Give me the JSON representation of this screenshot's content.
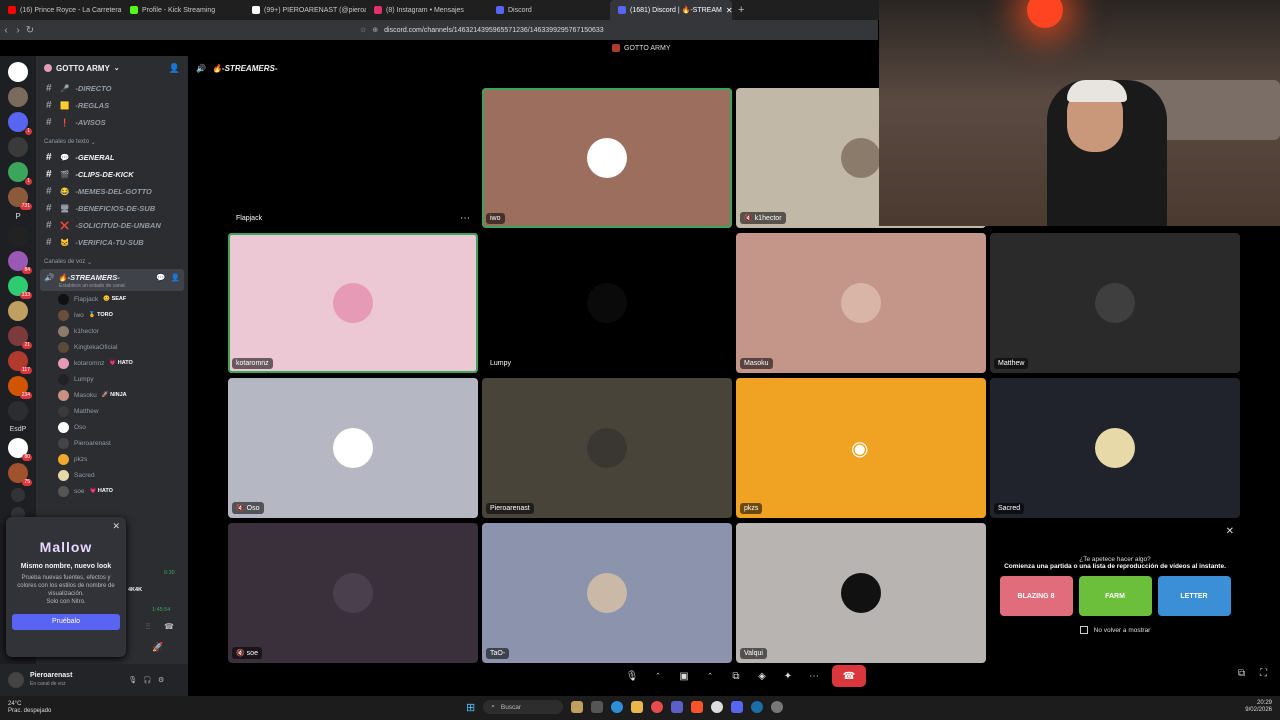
{
  "browser": {
    "tabs": [
      {
        "label": "(16) Prince Royce - La Carretera (Letr",
        "color": "#ff0000",
        "active": false
      },
      {
        "label": "Profile - Kick Streaming",
        "color": "#53fc18",
        "active": false
      },
      {
        "label": "(99+) PIEROARENAST (@pieroare",
        "color": "#ffffff",
        "active": false
      },
      {
        "label": "(8) Instagram • Mensajes",
        "color": "#e1306c",
        "active": false
      },
      {
        "label": "Discord",
        "color": "#5865f2",
        "active": false
      },
      {
        "label": "(1681) Discord | 🔥-STREAM",
        "color": "#5865f2",
        "active": true
      }
    ],
    "new_tab": "+",
    "url": "discord.com/channels/1463214395965571236/1463399295767150633",
    "window_title": "GOTTO ARMY"
  },
  "rail": {
    "servers": [
      {
        "color": "#ffffff",
        "badge": ""
      },
      {
        "color": "#7a6b5d",
        "badge": ""
      },
      {
        "color": "#5865f2",
        "badge": "1"
      },
      {
        "color": "#3a3a3a",
        "badge": ""
      },
      {
        "color": "#3ba55c",
        "badge": "1"
      },
      {
        "color": "#8a5a3a",
        "badge": "731"
      },
      {
        "color": "#222222",
        "badge": ""
      },
      {
        "color": "#9b59b6",
        "badge": "84"
      },
      {
        "color": "#2ecc71",
        "badge": "333"
      },
      {
        "color": "#c0a060",
        "badge": ""
      },
      {
        "color": "#7c3a3a",
        "badge": "21"
      },
      {
        "color": "#b03a2e",
        "badge": "117"
      },
      {
        "color": "#d35400",
        "badge": "234"
      },
      {
        "color": "#2b2d31",
        "badge": ""
      },
      {
        "color": "#ffffff",
        "badge": "80"
      },
      {
        "color": "#a0522d",
        "badge": "75"
      }
    ],
    "esdp_label": "EsdP",
    "p_label": "P"
  },
  "channels": {
    "server_name": "GOTTO ARMY",
    "top": [
      {
        "icon": "🎤",
        "name": "-DIRECTO"
      },
      {
        "icon": "🟨",
        "name": "-REGLAS"
      },
      {
        "icon": "❗",
        "name": "-AVISOS"
      }
    ],
    "text_category": "Canales de texto",
    "text": [
      {
        "icon": "💬",
        "name": "-GENERAL",
        "active": true
      },
      {
        "icon": "🎬",
        "name": "-CLIPS-DE-KICK",
        "active": true
      },
      {
        "icon": "😂",
        "name": "-MEMES-DEL-GOTTO",
        "active": false
      },
      {
        "icon": "🖥",
        "name": "-BENEFICIOS-DE-SUB",
        "active": false
      },
      {
        "icon": "❌",
        "name": "-SOLICITUD-DE-UNBAN",
        "active": false
      },
      {
        "icon": "🐱",
        "name": "-VERIFICA-TU-SUB",
        "active": false
      }
    ],
    "voice_category": "Canales de voz",
    "voice_channel": "🔥-STREAMERS-",
    "voice_status": "Establece un estado de canal",
    "members": [
      {
        "name": "Flapjack",
        "tag": "😊 SEAF",
        "color": "#111111"
      },
      {
        "name": "iwo",
        "tag": "🏅 TORO",
        "color": "#6b4d3c"
      },
      {
        "name": "k1hector",
        "tag": "",
        "color": "#8b7b6b"
      },
      {
        "name": "KingtekaOficial",
        "tag": "",
        "color": "#5a4a3a"
      },
      {
        "name": "kotaromnz",
        "tag": "💗 HATO",
        "color": "#e69ab5"
      },
      {
        "name": "Lumpy",
        "tag": "",
        "color": "#222222"
      },
      {
        "name": "Masoku",
        "tag": "🚀 NINJA",
        "color": "#c98f80"
      },
      {
        "name": "Matthew",
        "tag": "",
        "color": "#3a3a3a"
      },
      {
        "name": "Oso",
        "tag": "",
        "color": "#ffffff"
      },
      {
        "name": "Pieroarenast",
        "tag": "",
        "color": "#444444"
      },
      {
        "name": "pkzs",
        "tag": "",
        "color": "#f0a830"
      },
      {
        "name": "Sacred",
        "tag": "",
        "color": "#e8d9a8"
      },
      {
        "name": "soe",
        "tag": "💗 HATO",
        "color": "#555555"
      }
    ],
    "extra_tag": "4K4K",
    "time_1": "6:30",
    "time_2": "1:45:54"
  },
  "nitro_popup": {
    "logo": "Mallow",
    "title": "Mismo nombre, nuevo look",
    "body": "Prueba nuevas fuentes, efectos y colores con los estilos de nombre de visualización.",
    "note": "Solo con Nitro.",
    "button": "Pruébalo",
    "close": "✕"
  },
  "user_panel": {
    "username": "Pieroarenast",
    "status": "En canal de voz"
  },
  "stage": {
    "channel_title": "🔥-STREAMERS-",
    "tiles": [
      {
        "name": "Flapjack",
        "bg": "#000000",
        "avatar": "#000000",
        "col": 0,
        "row": 0,
        "speaking": false,
        "muted": false
      },
      {
        "name": "iwo",
        "bg": "#9c6e5e",
        "avatar": "#ffffff",
        "col": 1,
        "row": 0,
        "speaking": true,
        "muted": false
      },
      {
        "name": "k1hector",
        "bg": "#c2b8a8",
        "avatar": "#8b7b6b",
        "col": 2,
        "row": 0,
        "speaking": false,
        "muted": true
      },
      {
        "name": "kotaromnz",
        "bg": "#ecc7d4",
        "avatar": "#e69ab5",
        "col": 0,
        "row": 1,
        "speaking": true,
        "muted": false
      },
      {
        "name": "Lumpy",
        "bg": "#000000",
        "avatar": "#0a0a0a",
        "col": 1,
        "row": 1,
        "speaking": false,
        "muted": false
      },
      {
        "name": "Masoku",
        "bg": "#c4968a",
        "avatar": "#d9b5a8",
        "col": 2,
        "row": 1,
        "speaking": false,
        "muted": false
      },
      {
        "name": "Matthew",
        "bg": "#2a2a2a",
        "avatar": "#3f3f3f",
        "col": 3,
        "row": 1,
        "speaking": false,
        "muted": false
      },
      {
        "name": "Oso",
        "bg": "#b5b8c2",
        "avatar": "#ffffff",
        "col": 0,
        "row": 2,
        "speaking": false,
        "muted": true
      },
      {
        "name": "Pieroarenast",
        "bg": "#48443a",
        "avatar": "#3a3632",
        "col": 1,
        "row": 2,
        "speaking": false,
        "muted": false
      },
      {
        "name": "pkzs",
        "bg": "#f0a322",
        "avatar": "#f0a322",
        "col": 2,
        "row": 2,
        "speaking": false,
        "muted": false
      },
      {
        "name": "Sacred",
        "bg": "#20232c",
        "avatar": "#e8d9a8",
        "col": 3,
        "row": 2,
        "speaking": false,
        "muted": false
      },
      {
        "name": "soe",
        "bg": "#3a303c",
        "avatar": "#4a3f4d",
        "col": 0,
        "row": 3,
        "speaking": false,
        "muted": true
      },
      {
        "name": "TaO-",
        "bg": "#8b93ad",
        "avatar": "#c9b9a6",
        "col": 1,
        "row": 3,
        "speaking": false,
        "muted": false
      },
      {
        "name": "Valqui",
        "bg": "#b8b4b2",
        "avatar": "#111111",
        "col": 2,
        "row": 3,
        "speaking": false,
        "muted": false
      }
    ],
    "promo": {
      "question": "¿Te apetece hacer algo?",
      "subtitle": "Comienza una partida o una lista de reproducción de vídeos al instante.",
      "games": [
        {
          "label": "BLAZING 8",
          "color": "#e06c7c"
        },
        {
          "label": "FARM",
          "color": "#6bbf3a"
        },
        {
          "label": "LETTER",
          "color": "#3a8fd6"
        }
      ],
      "checkbox_label": "No volver a mostrar",
      "close": "✕"
    }
  },
  "taskbar": {
    "temperature": "24°C",
    "weather": "Prac. despejado",
    "search": "Buscar",
    "time": "20:29",
    "date": "9/02/2026"
  }
}
